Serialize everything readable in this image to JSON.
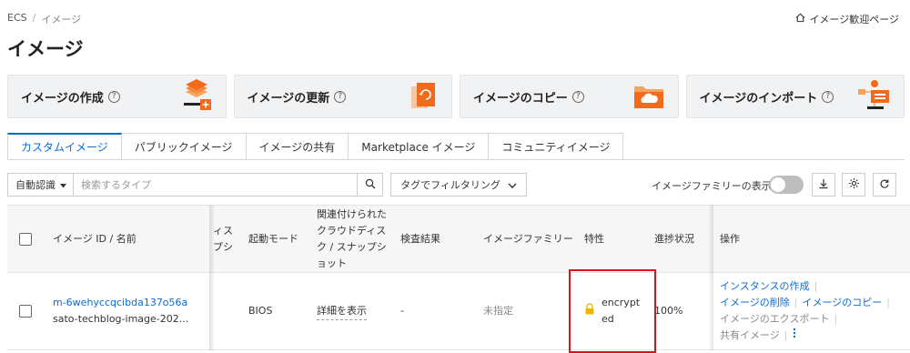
{
  "breadcrumb": {
    "root": "ECS",
    "separator": "/",
    "current": "イメージ"
  },
  "top_link": "イメージ歓迎ページ",
  "page_title": "イメージ",
  "cards": [
    {
      "label": "イメージの作成"
    },
    {
      "label": "イメージの更新"
    },
    {
      "label": "イメージのコピー"
    },
    {
      "label": "イメージのインポート"
    }
  ],
  "help_glyph": "?",
  "tabs": [
    {
      "label": "カスタムイメージ",
      "active": true
    },
    {
      "label": "パブリックイメージ"
    },
    {
      "label": "イメージの共有"
    },
    {
      "label": "Marketplace イメージ"
    },
    {
      "label": "コミュニティイメージ"
    }
  ],
  "toolbar": {
    "search_type": "自動認識",
    "search_placeholder": "検索するタイプ",
    "tag_filter": "タグでフィルタリング",
    "family_toggle_label": "イメージファミリーの表示",
    "family_toggle_on": false
  },
  "table": {
    "headers": {
      "id_name": "イメージ ID / 名前",
      "hidden_partial": "ィス\nプシ",
      "boot_mode": "起動モード",
      "related": "関連付けられた\nクラウドディス\nク / スナップシ\nョット",
      "inspection": "検査結果",
      "family": "イメージファミリー",
      "features": "特性",
      "progress": "進捗状況",
      "actions": "操作"
    },
    "rows": [
      {
        "image_id": "m-6wehyccqcibda137o56a",
        "name": "sato-techblog-image-202...",
        "boot_mode": "BIOS",
        "related": "詳細を表示",
        "inspection": "-",
        "family": "未指定",
        "feature": "encrypted",
        "progress": "100%",
        "actions": {
          "create_instance": "インスタンスの作成",
          "delete_image": "イメージの削除",
          "copy_image": "イメージのコピー",
          "export_image": "イメージのエクスポート",
          "share_image": "共有イメージ"
        }
      }
    ]
  },
  "colors": {
    "link": "#0b6bd6",
    "highlight": "#d9141c",
    "lock": "#f2b705"
  }
}
